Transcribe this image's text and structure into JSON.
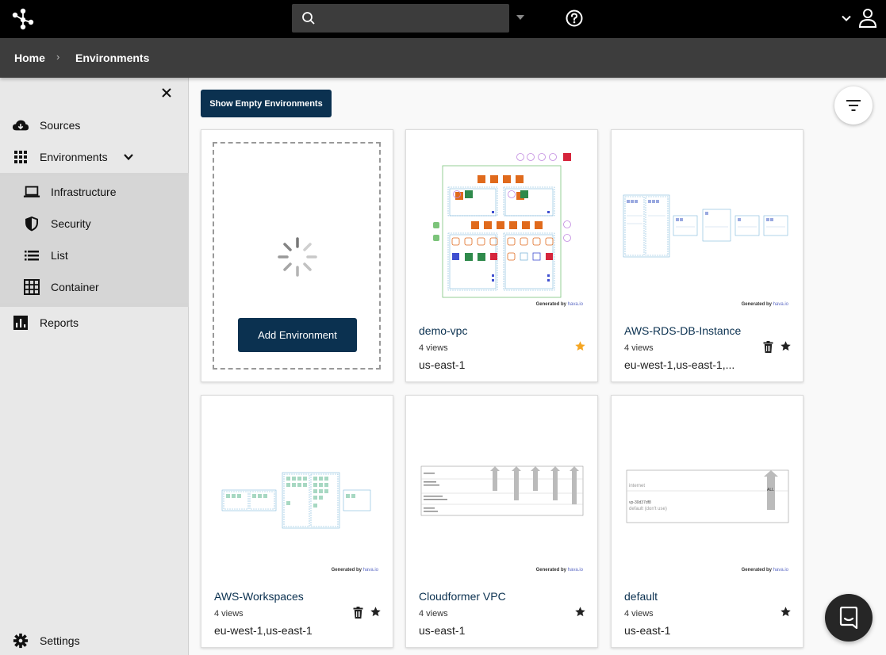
{
  "header": {
    "search_placeholder": "",
    "search_value": ""
  },
  "breadcrumb": {
    "home": "Home",
    "separator": "›",
    "current": "Environments"
  },
  "sidebar": {
    "items": [
      {
        "label": "Sources",
        "icon": "cloud-download-icon"
      },
      {
        "label": "Environments",
        "icon": "grid-icon"
      },
      {
        "label": "Infrastructure",
        "icon": "laptop-icon"
      },
      {
        "label": "Security",
        "icon": "shield-icon"
      },
      {
        "label": "List",
        "icon": "list-icon"
      },
      {
        "label": "Container",
        "icon": "table-icon"
      },
      {
        "label": "Reports",
        "icon": "bar-chart-icon"
      },
      {
        "label": "Settings",
        "icon": "gear-icon"
      }
    ]
  },
  "toolbar": {
    "show_empty_label": "Show Empty Environments"
  },
  "add_card": {
    "add_label": "Add Environment"
  },
  "generated_by": {
    "prefix": "Generated by",
    "brand": "hava.io"
  },
  "environments": [
    {
      "title": "demo-vpc",
      "views": "4 views",
      "region": "us-east-1",
      "starred": true
    },
    {
      "title": "AWS-RDS-DB-Instance",
      "views": "4 views",
      "region": "eu-west-1,us-east-1,...",
      "starred": false
    },
    {
      "title": "AWS-Workspaces",
      "views": "4 views",
      "region": "eu-west-1,us-east-1",
      "starred": false
    },
    {
      "title": "Cloudformer VPC",
      "views": "4 views",
      "region": "us-east-1",
      "starred": false
    },
    {
      "title": "default",
      "views": "4 views",
      "region": "us-east-1",
      "starred": false
    }
  ],
  "diagram_labels": {
    "internet": "internet",
    "default_vpc_id": "vp-30d37df8",
    "default_vpc_name": "default (don't use)",
    "all": "ALL"
  },
  "colors": {
    "primary": "#0b3150",
    "topbar": "#000000",
    "crumbbar": "#3d3d3d",
    "star_active": "#f5a623"
  }
}
